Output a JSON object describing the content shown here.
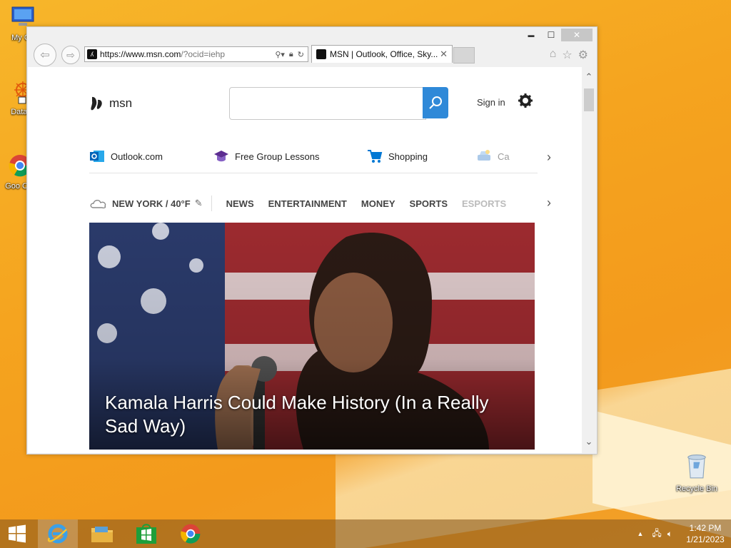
{
  "desktop": {
    "icons": [
      {
        "label": "My Co"
      },
      {
        "label": "DataW"
      },
      {
        "label": "Goo Chr"
      },
      {
        "label": "Recycle Bin"
      }
    ]
  },
  "browser": {
    "address": {
      "host": "https://www.msn.com",
      "path": "/?ocid=iehp"
    },
    "tab": {
      "title": "MSN | Outlook, Office, Sky..."
    },
    "window_controls": {
      "minimize": "▬",
      "maximize": "☐",
      "close": "✕"
    }
  },
  "msn": {
    "logo_text": "msn",
    "search": {
      "placeholder": ""
    },
    "sign_in": "Sign in",
    "quick_links": [
      {
        "label": "Outlook.com",
        "icon": "outlook-icon"
      },
      {
        "label": "Free Group Lessons",
        "icon": "graduation-cap-icon"
      },
      {
        "label": "Shopping",
        "icon": "shopping-cart-icon"
      },
      {
        "label": "Ca",
        "icon": "car-icon"
      }
    ],
    "weather": "NEW YORK / 40°F",
    "nav": [
      "NEWS",
      "ENTERTAINMENT",
      "MONEY",
      "SPORTS",
      "ESPORTS"
    ],
    "hero": {
      "headline": "Kamala Harris Could Make History (In a Really Sad Way)"
    }
  },
  "taskbar": {
    "clock_time": "1:42 PM",
    "clock_date": "1/21/2023"
  },
  "colors": {
    "accent": "#2f89d8",
    "desktop": "#f5a41f"
  }
}
